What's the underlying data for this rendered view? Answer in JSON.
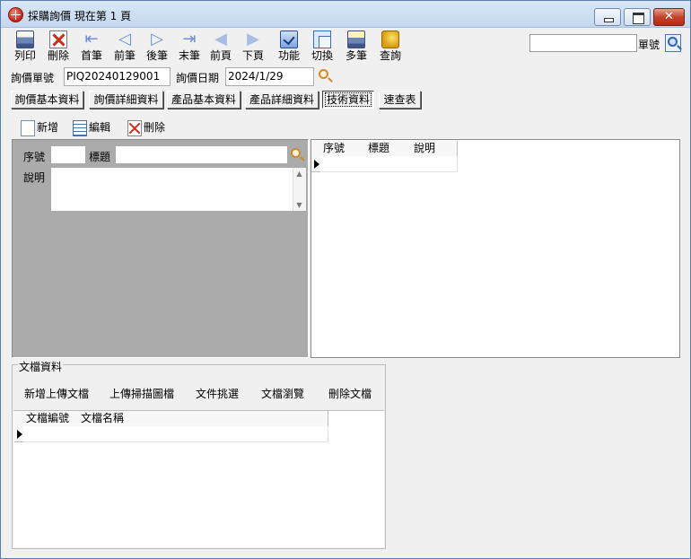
{
  "window": {
    "title": "採購詢價  現在第 1 頁",
    "close_glyph": "✕"
  },
  "toolbar": {
    "buttons": [
      {
        "label": "列印",
        "icon": "print-icon"
      },
      {
        "label": "刪除",
        "icon": "delete-icon"
      },
      {
        "label": "首筆",
        "icon": "first-record-icon"
      },
      {
        "label": "前筆",
        "icon": "previous-record-icon"
      },
      {
        "label": "後筆",
        "icon": "next-record-icon"
      },
      {
        "label": "末筆",
        "icon": "last-record-icon"
      },
      {
        "label": "前頁",
        "icon": "previous-page-icon"
      },
      {
        "label": "下頁",
        "icon": "next-page-icon"
      },
      {
        "label": "功能",
        "icon": "function-icon"
      },
      {
        "label": "切換",
        "icon": "switch-icon"
      },
      {
        "label": "多筆",
        "icon": "multi-record-icon"
      },
      {
        "label": "查詢",
        "icon": "query-icon"
      }
    ],
    "nav_glyphs": {
      "first": "⇤",
      "prev": "◁",
      "next": "▷",
      "last": "⇥",
      "prev_page": "◀",
      "next_page": "▶"
    },
    "search": {
      "value": "",
      "label": "單號"
    }
  },
  "header": {
    "inquiry_no_label": "詢價單號",
    "inquiry_no_value": "PIQ20240129001",
    "inquiry_date_label": "詢價日期",
    "inquiry_date_value": "2024/1/29"
  },
  "tabs": [
    {
      "label": "詢價基本資料",
      "active": false
    },
    {
      "label": "詢價詳細資料",
      "active": false
    },
    {
      "label": "產品基本資料",
      "active": false
    },
    {
      "label": "產品詳細資料",
      "active": false
    },
    {
      "label": "技術資料",
      "active": true
    },
    {
      "label": "速查表",
      "active": false
    }
  ],
  "sub_toolbar": {
    "add_label": "新增",
    "edit_label": "編輯",
    "delete_label": "刪除"
  },
  "detail_form": {
    "seq_label": "序號",
    "seq_value": "",
    "title_label": "標題",
    "title_value": "",
    "desc_label": "說明",
    "desc_value": ""
  },
  "tech_grid": {
    "columns": [
      "序號",
      "標題",
      "說明"
    ],
    "rows": [
      [
        "",
        "",
        ""
      ]
    ]
  },
  "documents": {
    "group_label": "文檔資料",
    "buttons": [
      "新增上傳文檔",
      "上傳掃描圖檔",
      "文件挑選",
      "文檔瀏覽",
      "刪除文檔"
    ],
    "columns": [
      "文檔編號",
      "文檔名稱"
    ],
    "rows": [
      [
        "",
        ""
      ]
    ]
  }
}
